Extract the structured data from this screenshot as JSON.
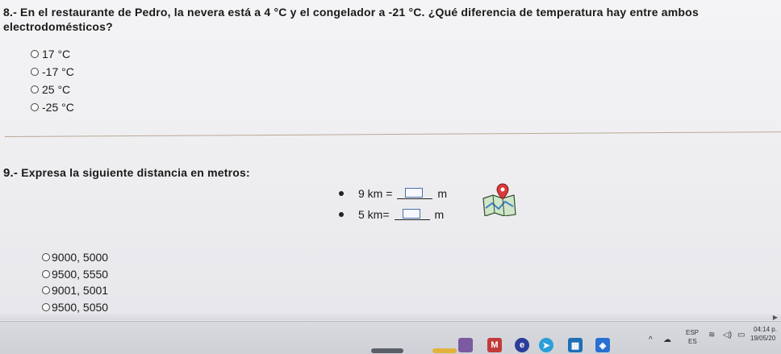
{
  "q8": {
    "title": "8.- En el restaurante de Pedro, la nevera está a 4 °C y el congelador a -21 °C. ¿Qué diferencia de temperatura hay entre ambos electrodomésticos?",
    "options": [
      "17 °C",
      "-17 °C",
      "25 °C",
      "-25 °C"
    ]
  },
  "q9": {
    "number": "9.-",
    "title": "Expresa la siguiente distancia en metros:",
    "equations": [
      {
        "left": "9 km =",
        "unit": "m"
      },
      {
        "left": "5 km=",
        "unit": "m"
      }
    ],
    "options": [
      "9000, 5000",
      "9500, 5550",
      "9001, 5001",
      "9500, 5050"
    ]
  },
  "taskbar": {
    "language": "ESP",
    "language_sub": "ES",
    "time": "04:14 p.",
    "date": "19/05/20"
  },
  "icons": [
    "map-icon",
    "chevron-up-icon",
    "wifi-icon",
    "volume-icon",
    "battery-icon",
    "mail-icon",
    "chrome-icon",
    "edge-icon",
    "telegram-icon",
    "store-icon"
  ]
}
